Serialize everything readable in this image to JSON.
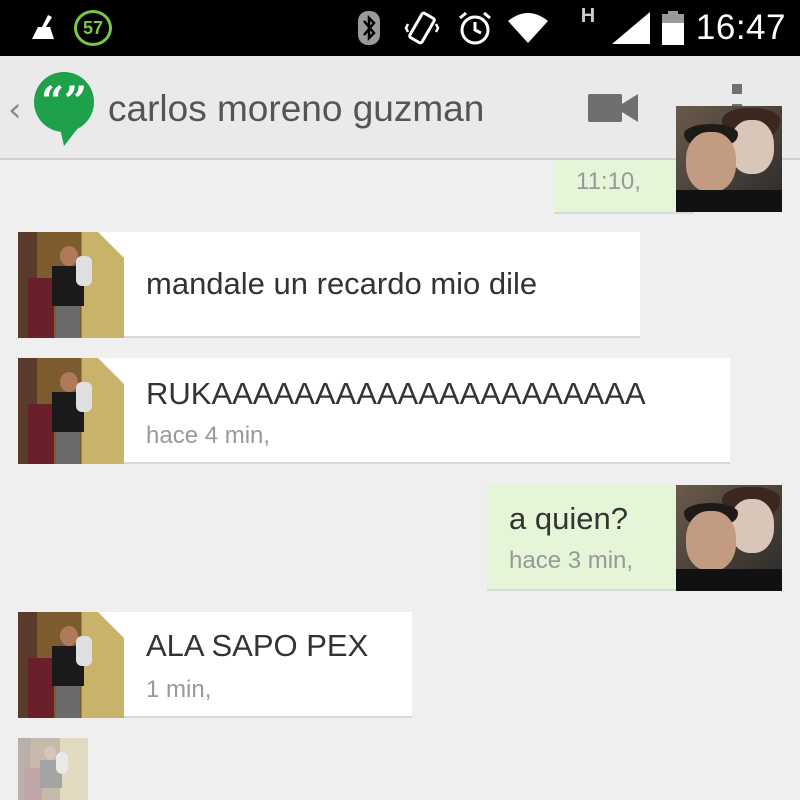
{
  "status_bar": {
    "battery_badge": "57",
    "network_type": "H",
    "time": "16:47",
    "icons": [
      "cleaner-icon",
      "battery-saver-icon",
      "bluetooth-icon",
      "vibrate-icon",
      "alarm-icon",
      "wifi-icon",
      "signal-icon",
      "battery-icon"
    ]
  },
  "app_bar": {
    "back_glyph": "‹",
    "logo_glyph": "“”",
    "contact_name": "carlos moreno guzman"
  },
  "messages": [
    {
      "direction": "out",
      "text": "",
      "time": "11:10,"
    },
    {
      "direction": "in",
      "text": "mandale un recardo  mio dile",
      "time": ""
    },
    {
      "direction": "in",
      "text": "RUKAAAAAAAAAAAAAAAAAAAAA",
      "time": "hace 4 min,"
    },
    {
      "direction": "out",
      "text": "a quien?",
      "time": "hace 3 min,"
    },
    {
      "direction": "in",
      "text": "ALA SAPO PEX",
      "time": "1 min,"
    }
  ],
  "colors": {
    "incoming_bubble": "#ffffff",
    "outgoing_bubble": "#e5f5d8",
    "hangouts_green": "#1fa04a",
    "background": "#efefef"
  }
}
